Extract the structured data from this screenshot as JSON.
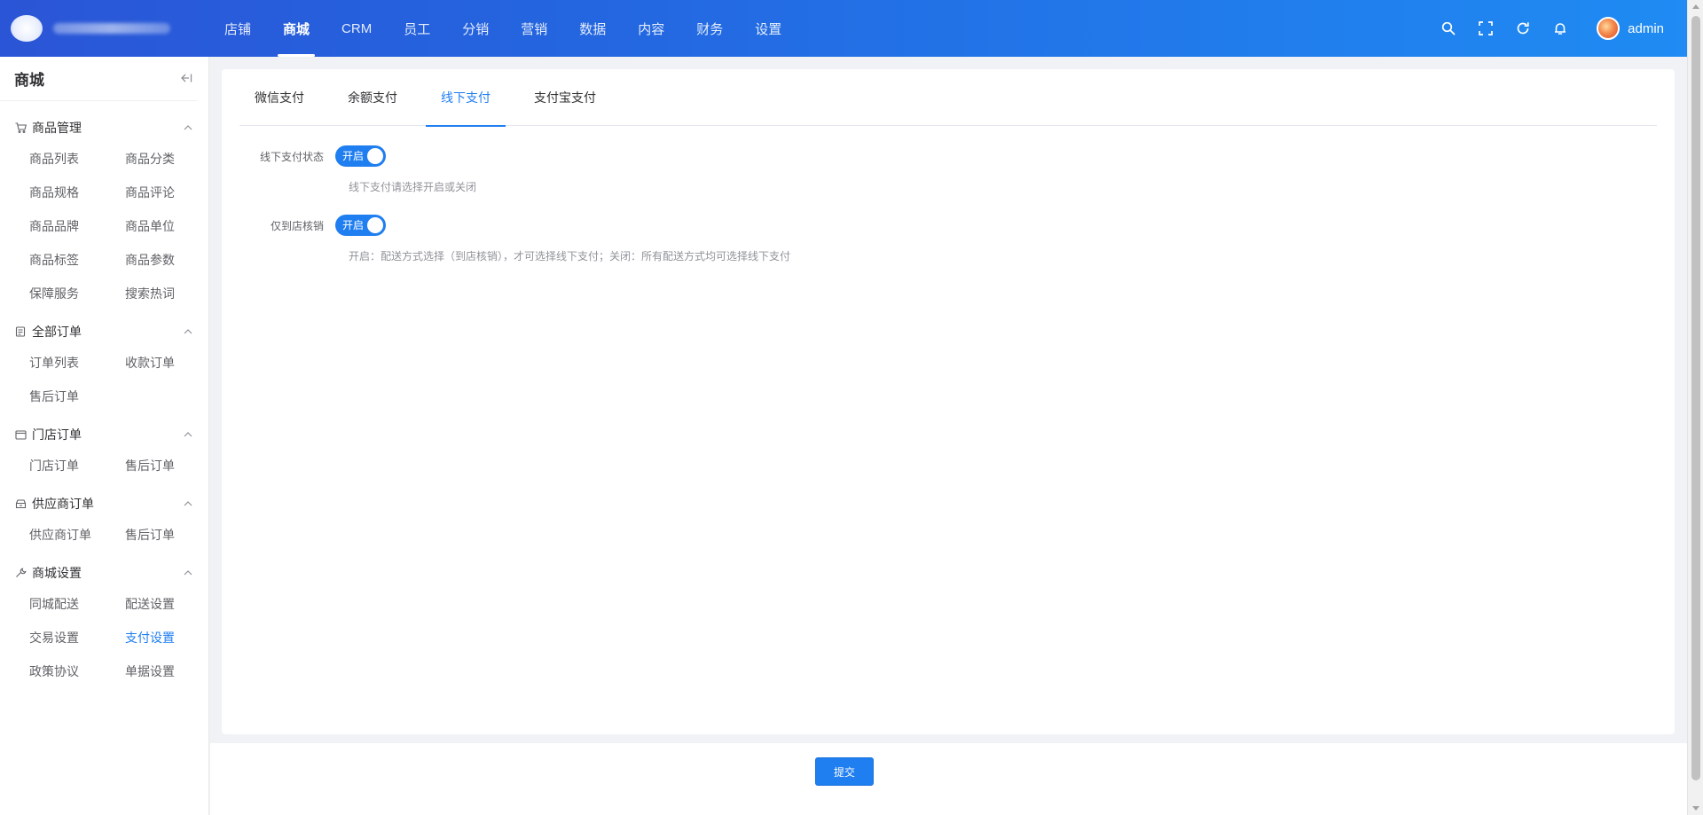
{
  "header": {
    "nav": [
      {
        "label": "店铺",
        "active": false
      },
      {
        "label": "商城",
        "active": true
      },
      {
        "label": "CRM",
        "active": false
      },
      {
        "label": "员工",
        "active": false
      },
      {
        "label": "分销",
        "active": false
      },
      {
        "label": "营销",
        "active": false
      },
      {
        "label": "数据",
        "active": false
      },
      {
        "label": "内容",
        "active": false
      },
      {
        "label": "财务",
        "active": false
      },
      {
        "label": "设置",
        "active": false
      }
    ],
    "icons": [
      "search-icon",
      "fullscreen-icon",
      "refresh-icon",
      "bell-icon"
    ],
    "username": "admin"
  },
  "sidebar": {
    "title": "商城",
    "groups": [
      {
        "title": "商品管理",
        "icon": "cart-icon",
        "items": [
          "商品列表",
          "商品分类",
          "商品规格",
          "商品评论",
          "商品品牌",
          "商品单位",
          "商品标签",
          "商品参数",
          "保障服务",
          "搜索热词"
        ]
      },
      {
        "title": "全部订单",
        "icon": "document-icon",
        "items": [
          "订单列表",
          "收款订单",
          "售后订单"
        ]
      },
      {
        "title": "门店订单",
        "icon": "shop-icon",
        "items": [
          "门店订单",
          "售后订单"
        ]
      },
      {
        "title": "供应商订单",
        "icon": "supplier-icon",
        "items": [
          "供应商订单",
          "售后订单"
        ]
      },
      {
        "title": "商城设置",
        "icon": "wrench-icon",
        "items": [
          "同城配送",
          "配送设置",
          "交易设置",
          "支付设置",
          "政策协议",
          "单据设置"
        ]
      }
    ],
    "active_item": "支付设置"
  },
  "tabs": [
    {
      "label": "微信支付",
      "active": false
    },
    {
      "label": "余额支付",
      "active": false
    },
    {
      "label": "线下支付",
      "active": true
    },
    {
      "label": "支付宝支付",
      "active": false
    }
  ],
  "form": {
    "offline_status": {
      "label": "线下支付状态",
      "switch_text": "开启",
      "on": true,
      "hint": "线下支付请选择开启或关闭"
    },
    "store_only": {
      "label": "仅到店核销",
      "switch_text": "开启",
      "on": true,
      "hint": "开启：配送方式选择（到店核销），才可选择线下支付；关闭：所有配送方式均可选择线下支付"
    }
  },
  "footer": {
    "submit_label": "提交"
  },
  "colors": {
    "primary": "#1f7ef0",
    "header_start": "#2a55d6",
    "header_end": "#1f8bf3"
  }
}
